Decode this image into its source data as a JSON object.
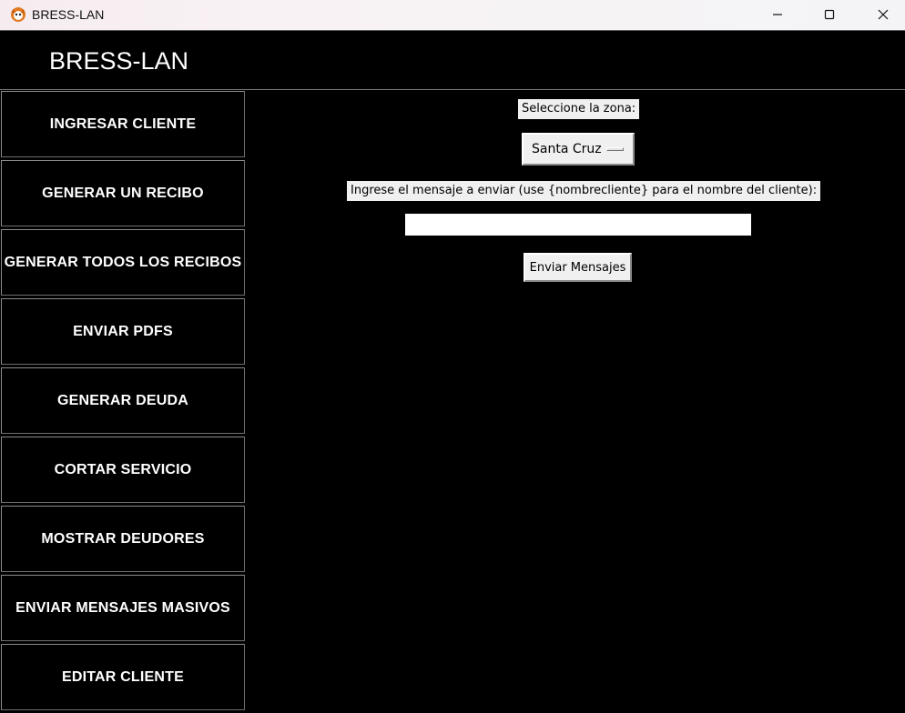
{
  "window": {
    "title": "BRESS-LAN",
    "icons": {
      "app": "fox-app-icon",
      "minimize": "minimize-icon",
      "maximize": "maximize-icon",
      "close": "close-icon"
    }
  },
  "header": {
    "brand": "BRESS-LAN"
  },
  "sidebar": {
    "items": [
      {
        "label": "INGRESAR CLIENTE"
      },
      {
        "label": "GENERAR UN RECIBO"
      },
      {
        "label": "GENERAR TODOS LOS RECIBOS"
      },
      {
        "label": "ENVIAR PDFS"
      },
      {
        "label": "GENERAR DEUDA"
      },
      {
        "label": "CORTAR SERVICIO"
      },
      {
        "label": "MOSTRAR DEUDORES"
      },
      {
        "label": "ENVIAR MENSAJES MASIVOS"
      },
      {
        "label": "EDITAR CLIENTE"
      }
    ]
  },
  "main": {
    "zone_label": "Seleccione la zona:",
    "zone_value": "Santa Cruz",
    "message_label": "Ingrese el mensaje a enviar (use {nombrecliente} para el nombre del cliente):",
    "message_value": "",
    "send_button": "Enviar Mensajes"
  },
  "colors": {
    "background": "#000000",
    "text": "#ffffff",
    "widget": "#f0f0f0"
  }
}
